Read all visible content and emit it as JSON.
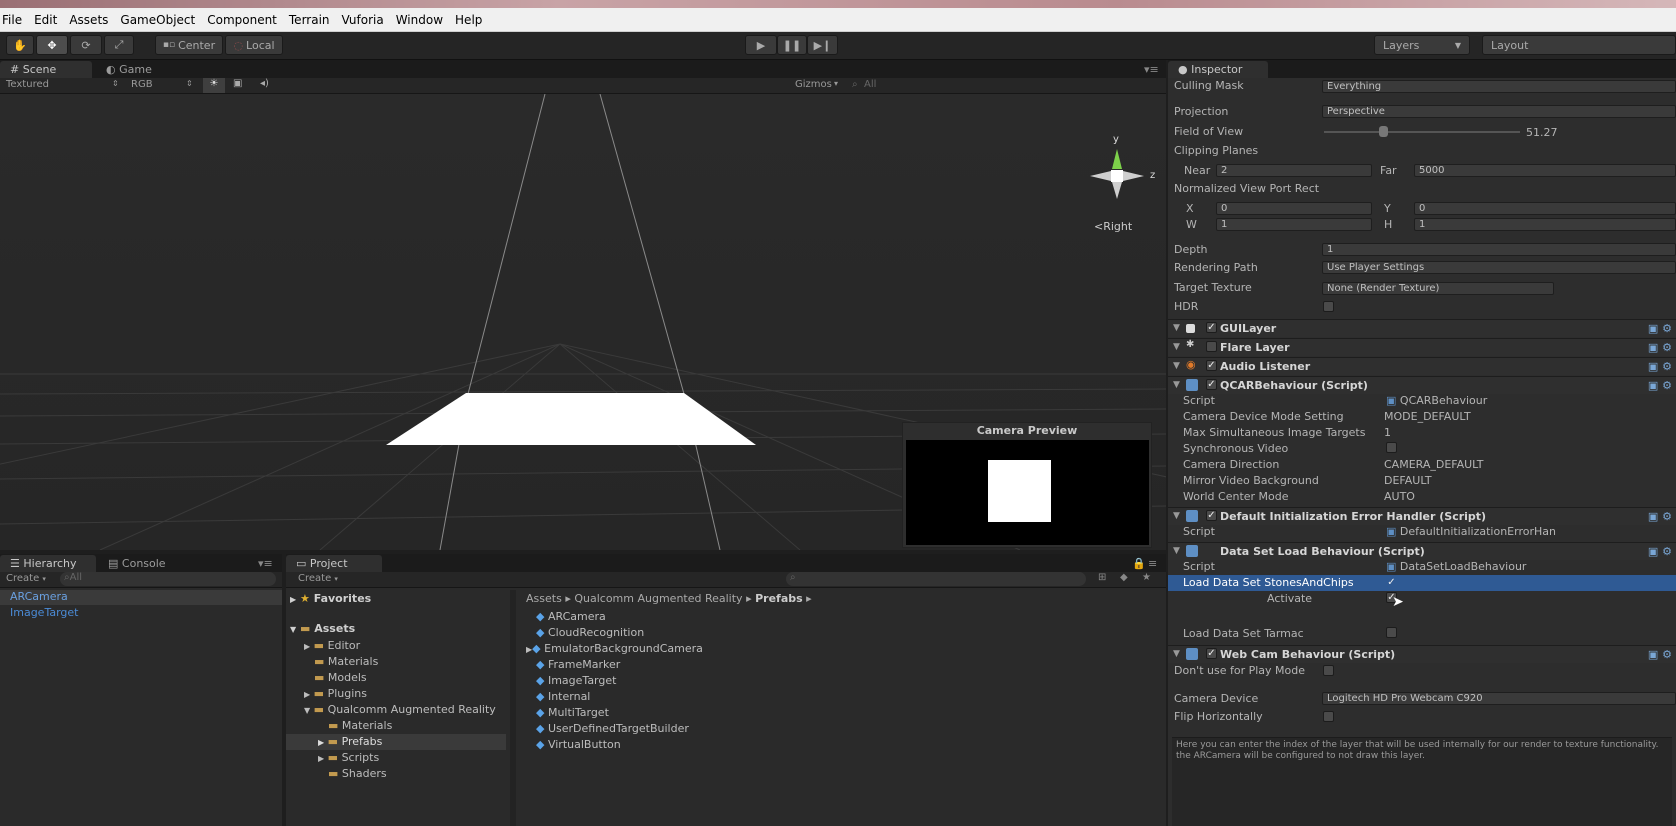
{
  "menu": [
    "File",
    "Edit",
    "Assets",
    "GameObject",
    "Component",
    "Terrain",
    "Vuforia",
    "Window",
    "Help"
  ],
  "toolbar": {
    "pivot": "Center",
    "space": "Local",
    "layers": "Layers",
    "layout": "Layout",
    "play_icon": "play-icon",
    "pause_icon": "pause-icon",
    "step_icon": "step-icon"
  },
  "scene": {
    "tab_scene": "Scene",
    "tab_game": "Game",
    "render_mode": "Textured",
    "color_mode": "RGB",
    "gizmos": "Gizmos",
    "search_placeholder": "All",
    "gizmo_y": "y",
    "gizmo_z": "z",
    "view_label": "Right",
    "camera_preview": "Camera Preview"
  },
  "hierarchy": {
    "tab": "Hierarchy",
    "tab_console": "Console",
    "create": "Create",
    "search_placeholder": "All",
    "items": [
      "ARCamera",
      "ImageTarget"
    ]
  },
  "project": {
    "tab": "Project",
    "create": "Create",
    "favorites": "Favorites",
    "assets": "Assets",
    "tree": [
      "Editor",
      "Materials",
      "Models",
      "Plugins",
      "Qualcomm Augmented Reality",
      "Materials",
      "Prefabs",
      "Scripts",
      "Shaders"
    ],
    "breadcrumb": [
      "Assets",
      "Qualcomm Augmented Reality",
      "Prefabs"
    ],
    "files": [
      "ARCamera",
      "CloudRecognition",
      "EmulatorBackgroundCamera",
      "FrameMarker",
      "ImageTarget",
      "Internal",
      "MultiTarget",
      "UserDefinedTargetBuilder",
      "VirtualButton"
    ]
  },
  "inspector": {
    "tab": "Inspector",
    "culling_mask_label": "Culling Mask",
    "culling_mask": "Everything",
    "projection_label": "Projection",
    "projection": "Perspective",
    "fov_label": "Field of View",
    "fov": "51.27",
    "fov_fraction": 0.3,
    "clipping_label": "Clipping Planes",
    "near_label": "Near",
    "near": "2",
    "far_label": "Far",
    "far": "5000",
    "viewport_label": "Normalized View Port Rect",
    "vp_x_label": "X",
    "vp_x": "0",
    "vp_y_label": "Y",
    "vp_y": "0",
    "vp_w_label": "W",
    "vp_w": "1",
    "vp_h_label": "H",
    "vp_h": "1",
    "depth_label": "Depth",
    "depth": "1",
    "rendering_path_label": "Rendering Path",
    "rendering_path": "Use Player Settings",
    "target_texture_label": "Target Texture",
    "target_texture": "None (Render Texture)",
    "hdr_label": "HDR",
    "gui_layer": "GUILayer",
    "flare_layer": "Flare Layer",
    "audio_listener": "Audio Listener",
    "qcar": "QCARBehaviour (Script)",
    "qcar_script_label": "Script",
    "qcar_script": "QCARBehaviour",
    "cam_mode_label": "Camera Device Mode Setting",
    "cam_mode": "MODE_DEFAULT",
    "max_targets_label": "Max Simultaneous Image Targets",
    "max_targets": "1",
    "sync_video_label": "Synchronous Video",
    "cam_dir_label": "Camera Direction",
    "cam_dir": "CAMERA_DEFAULT",
    "mirror_label": "Mirror Video Background",
    "mirror": "DEFAULT",
    "world_center_label": "World Center Mode",
    "world_center": "AUTO",
    "default_init": "Default Initialization Error Handler (Script)",
    "default_init_script_label": "Script",
    "default_init_script": "DefaultInitializationErrorHan",
    "dataset": "Data Set Load Behaviour (Script)",
    "dataset_script_label": "Script",
    "dataset_script": "DataSetLoadBehaviour",
    "load_stones_label": "Load Data Set StonesAndChips",
    "activate_label": "Activate",
    "load_tarmac_label": "Load Data Set Tarmac",
    "webcam": "Web Cam Behaviour (Script)",
    "dont_use_label": "Don't use for Play Mode",
    "camera_device_label": "Camera Device",
    "camera_device": "Logitech HD Pro Webcam C920",
    "flip_label": "Flip Horizontally",
    "help_text": "Here you can enter the index of the layer that will be used internally for our render to texture functionality. the ARCamera will be configured to not draw this layer."
  }
}
